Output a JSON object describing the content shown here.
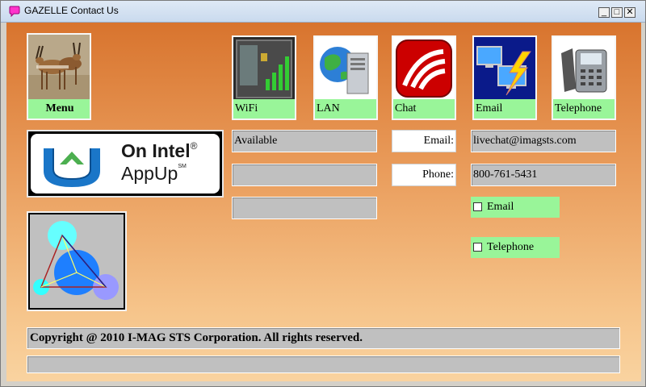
{
  "window": {
    "title": "GAZELLE Contact Us",
    "minimize_symbol": "_",
    "maximize_symbol": "□",
    "close_symbol": "✕"
  },
  "menu_tile": {
    "label": "Menu",
    "icon": "gazelle-photo"
  },
  "appup_logo": {
    "line1": "On Intel",
    "line2": "AppUp",
    "registered": "®",
    "servicemark": "SM"
  },
  "connections": [
    {
      "label": "WiFi",
      "icon": "wifi-signal-icon"
    },
    {
      "label": "LAN",
      "icon": "lan-server-icon"
    },
    {
      "label": "Chat",
      "icon": "chat-icon"
    },
    {
      "label": "Email",
      "icon": "email-computers-icon"
    },
    {
      "label": "Telephone",
      "icon": "telephone-icon"
    }
  ],
  "status": {
    "wifi": "Available",
    "field2": "",
    "field3": ""
  },
  "contact": {
    "email_label": "Email:",
    "email_value": "livechat@imagsts.com",
    "phone_label": "Phone:",
    "phone_value": "800-761-5431"
  },
  "options": [
    {
      "label": "Email",
      "checked": false
    },
    {
      "label": "Telephone",
      "checked": false
    }
  ],
  "footer": {
    "copyright": "Copyright @ 2010 I-MAG STS Corporation. All rights reserved.",
    "status": ""
  },
  "colors": {
    "label_green": "#99f599",
    "field_gray": "#c0c0c0",
    "bg_top": "#d8742e",
    "bg_bottom": "#f9d3a0"
  }
}
